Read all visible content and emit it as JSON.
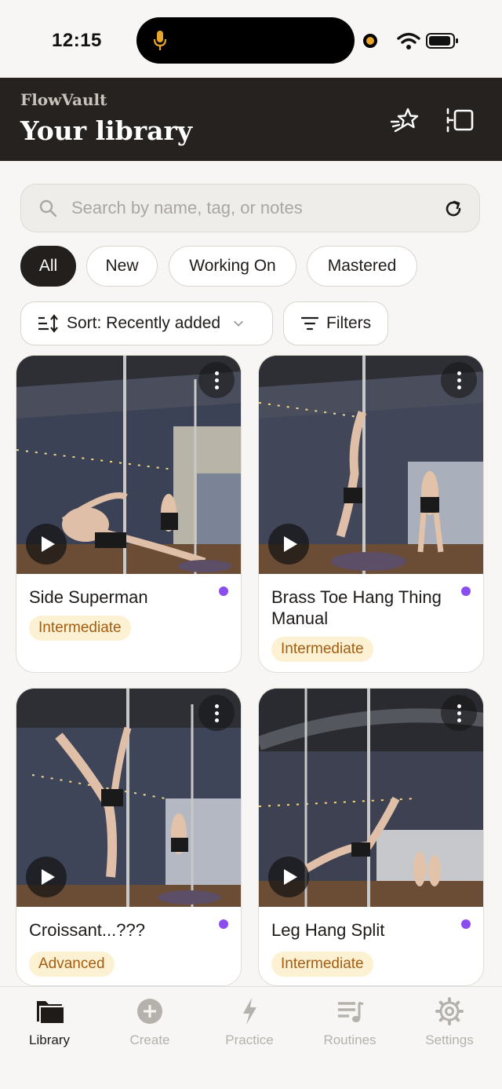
{
  "status_bar": {
    "time": "12:15"
  },
  "header": {
    "brand": "FlowVault",
    "title": "Your library",
    "icons": [
      "favorites-star-icon",
      "cast-icon"
    ]
  },
  "search": {
    "placeholder": "Search by name, tag, or notes",
    "value": ""
  },
  "filter_chips": [
    {
      "label": "All",
      "active": true
    },
    {
      "label": "New",
      "active": false
    },
    {
      "label": "Working On",
      "active": false
    },
    {
      "label": "Mastered",
      "active": false
    }
  ],
  "controls": {
    "sort_label": "Sort: Recently added",
    "filters_label": "Filters"
  },
  "cards": [
    {
      "title": "Side Superman",
      "level": "Intermediate",
      "has_new_dot": true
    },
    {
      "title": "Brass Toe Hang Thing Manual",
      "level": "Intermediate",
      "has_new_dot": true
    },
    {
      "title": "Croissant...???",
      "level": "Advanced",
      "has_new_dot": true
    },
    {
      "title": "Leg Hang Split",
      "level": "Intermediate",
      "has_new_dot": true
    }
  ],
  "colors": {
    "header_bg": "#262220",
    "chip_active_bg": "#231f1d",
    "level_badge_bg": "#fdf1d3",
    "level_badge_text": "#a45d10",
    "dot": "#8a4ef0"
  },
  "tabs": [
    {
      "label": "Library",
      "icon": "folder-icon",
      "active": true
    },
    {
      "label": "Create",
      "icon": "plus-circle-icon",
      "active": false
    },
    {
      "label": "Practice",
      "icon": "bolt-icon",
      "active": false
    },
    {
      "label": "Routines",
      "icon": "playlist-icon",
      "active": false
    },
    {
      "label": "Settings",
      "icon": "gear-icon",
      "active": false
    }
  ]
}
